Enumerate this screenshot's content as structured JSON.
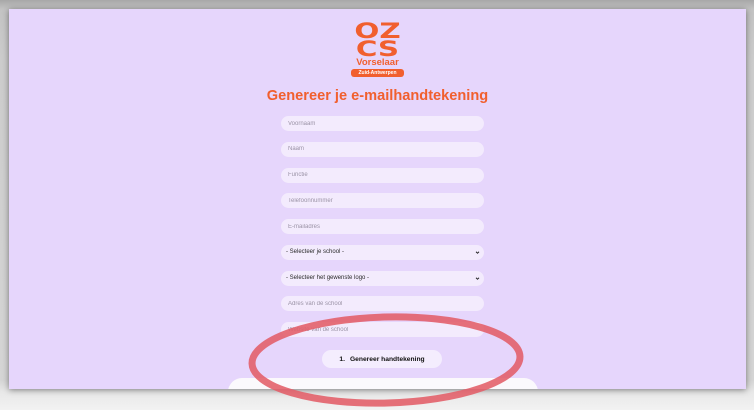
{
  "colors": {
    "page_background": "#e6d6fc",
    "accent": "#f15f2e",
    "field_background": "#f3ebfd",
    "annotation": "#e35d68"
  },
  "icons": {
    "select_arrow": "chevron-down-icon"
  },
  "logo": {
    "line1": "OZ",
    "line2": "CS",
    "name": "Vorselaar",
    "region": "Zuid-Antwerpen"
  },
  "form": {
    "title": "Genereer je e-mailhandtekening",
    "first_name": {
      "placeholder": "Voornaam"
    },
    "last_name": {
      "placeholder": "Naam"
    },
    "job_title": {
      "placeholder": "Functie"
    },
    "phone": {
      "placeholder": "Telefoonnummer"
    },
    "email": {
      "placeholder": "E-mailadres"
    },
    "school_select": {
      "selected": "- Selecteer je school -"
    },
    "logo_select": {
      "selected": "- Selecteer het gewenste logo -"
    },
    "school_address": {
      "placeholder": "Adres van de school"
    },
    "school_website": {
      "placeholder": "Website van de school"
    },
    "generate_button": {
      "step": "1.",
      "label": "Genereer handtekening"
    }
  }
}
